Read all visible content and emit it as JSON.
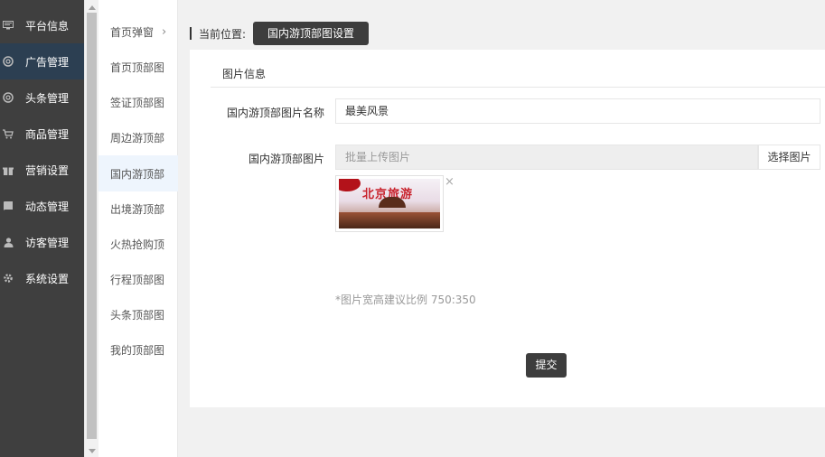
{
  "sidebar": {
    "items": [
      {
        "label": "平台信息",
        "icon": "monitor-icon"
      },
      {
        "label": "广告管理",
        "icon": "globe-icon"
      },
      {
        "label": "头条管理",
        "icon": "globe-icon"
      },
      {
        "label": "商品管理",
        "icon": "cart-icon"
      },
      {
        "label": "营销设置",
        "icon": "gift-icon"
      },
      {
        "label": "动态管理",
        "icon": "book-icon"
      },
      {
        "label": "访客管理",
        "icon": "user-icon"
      },
      {
        "label": "系统设置",
        "icon": "gear-icon"
      }
    ],
    "active_index": 1
  },
  "submenu": {
    "items": [
      {
        "label": "首页弹窗"
      },
      {
        "label": "首页顶部图"
      },
      {
        "label": "签证顶部图"
      },
      {
        "label": "周边游顶部"
      },
      {
        "label": "国内游顶部"
      },
      {
        "label": "出境游顶部"
      },
      {
        "label": "火热抢购顶"
      },
      {
        "label": "行程顶部图"
      },
      {
        "label": "头条顶部图"
      },
      {
        "label": "我的顶部图"
      }
    ],
    "chevron": "›",
    "active_index": 4
  },
  "breadcrumb": {
    "label": "当前位置:",
    "current": "国内游顶部图设置"
  },
  "form": {
    "section_title": "图片信息",
    "name_label": "国内游顶部图片名称",
    "name_value": "最美风景",
    "image_label": "国内游顶部图片",
    "upload_placeholder": "批量上传图片",
    "choose_button": "选择图片",
    "thumbnail_text": "北京旅游",
    "remove_icon": "×",
    "hint": "*图片宽高建议比例 750:350",
    "submit": "提交"
  },
  "colors": {
    "sidebar_bg": "#3f3f3f",
    "sidebar_active": "#2c3f52",
    "button_dark": "#3d3d3d",
    "submenu_active": "#eef5fd"
  }
}
